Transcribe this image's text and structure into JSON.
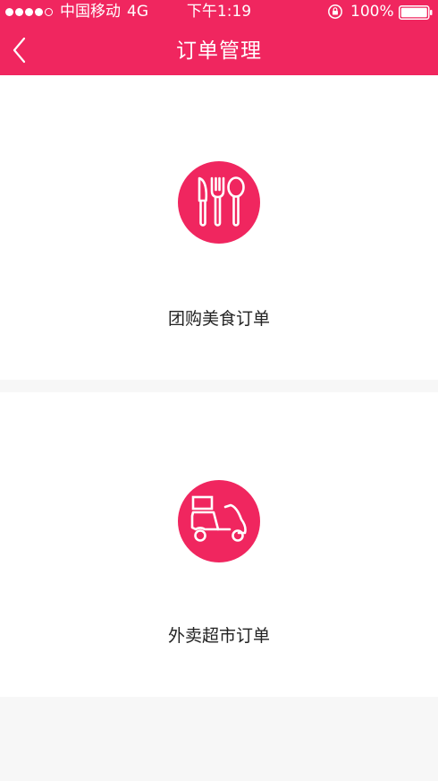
{
  "status_bar": {
    "carrier": "中国移动",
    "network": "4G",
    "time": "下午1:19",
    "battery_percent": "100%"
  },
  "nav": {
    "title": "订单管理",
    "back_icon": "chevron-left-icon"
  },
  "cards": [
    {
      "label": "团购美食订单",
      "icon": "utensils-icon"
    },
    {
      "label": "外卖超市订单",
      "icon": "scooter-icon"
    }
  ],
  "colors": {
    "brand": "#f0265f",
    "card_background": "#ffffff",
    "page_background": "#f7f7f7",
    "text": "#222222"
  }
}
